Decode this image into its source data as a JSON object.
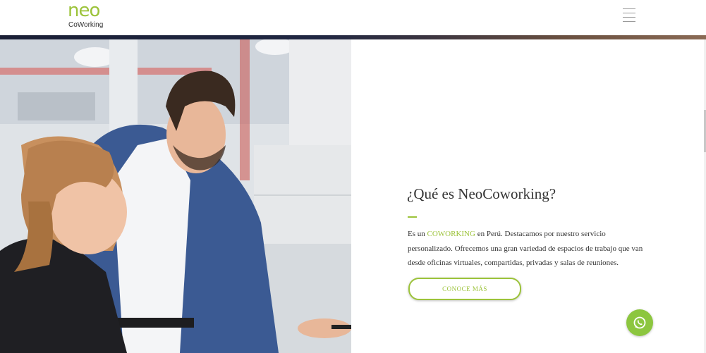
{
  "header": {
    "logo_word": "neo",
    "logo_sub": "CoWorking",
    "menu_icon": "hamburger-menu-icon"
  },
  "hero": {
    "image": "photo of two colleagues smiling at a laptop in an office"
  },
  "content": {
    "heading": "¿Qué es NeoCoworking?",
    "desc_before": "Es un ",
    "desc_highlight": "COWORKING",
    "desc_after": " en Perú. Destacamos por nuestro servicio personalizado. Ofrecemos una gran variedad de espacios de trabajo que van desde oficinas virtuales, compartidas, privadas y salas de reuniones.",
    "cta_label": "CONOCE MÁS"
  },
  "floating": {
    "whatsapp_icon": "whatsapp-icon"
  },
  "colors": {
    "brand_green": "#9cc33a",
    "whatsapp_green": "#8cc63f",
    "text": "#333333"
  }
}
